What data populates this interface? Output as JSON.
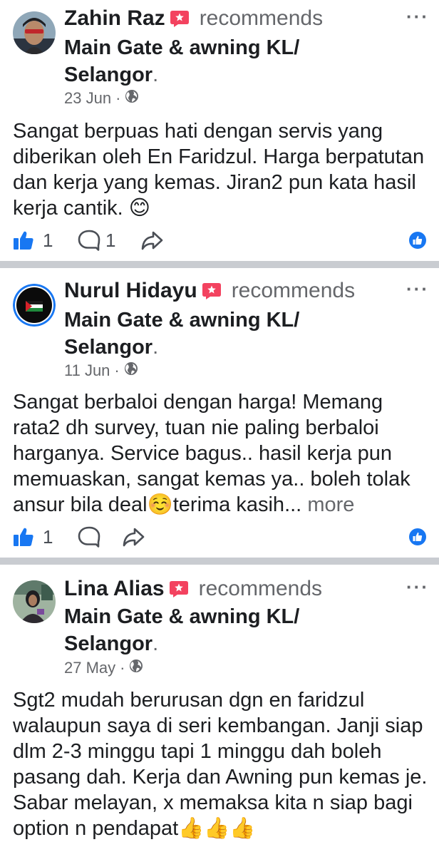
{
  "posts": [
    {
      "author": "Zahin Raz",
      "action": "recommends",
      "page_name_line1": "Main Gate & awning KL/",
      "page_name_line2": "Selangor",
      "page_name_end": ".",
      "date": "23 Jun",
      "separator": "·",
      "privacy_icon": "globe-icon",
      "text": "Sangat berpuas hati dengan servis yang diberikan oleh En Faridzul. Harga berpatutan dan kerja yang kemas. Jiran2 pun kata hasil kerja cantik. 😊",
      "see_more": "",
      "like_count": "1",
      "comment_count": "1"
    },
    {
      "author": "Nurul Hidayu",
      "action": "recommends",
      "page_name_line1": "Main Gate & awning KL/",
      "page_name_line2": "Selangor",
      "page_name_end": ".",
      "date": "11 Jun",
      "separator": "·",
      "privacy_icon": "globe-icon",
      "text": "Sangat berbaloi dengan harga! Memang rata2 dh survey, tuan nie paling berbaloi harganya. Service bagus.. hasil kerja pun memuaskan, sangat kemas ya.. boleh tolak ansur bila deal☺️terima kasih...",
      "see_more": "more",
      "like_count": "1",
      "comment_count": ""
    },
    {
      "author": "Lina Alias",
      "action": "recommends",
      "page_name_line1": "Main Gate & awning KL/",
      "page_name_line2": "Selangor",
      "page_name_end": ".",
      "date": "27 May",
      "separator": "·",
      "privacy_icon": "globe-icon",
      "text": "Sgt2 mudah berurusan dgn en faridzul walaupun saya di seri kembangan. Janji siap dlm 2-3 minggu tapi 1 minggu dah boleh pasang dah. Kerja dan Awning pun kemas je. Sabar melayan, x memaksa kita n siap bagi option n pendapat👍👍👍",
      "see_more": "",
      "like_count": "",
      "comment_count": ""
    }
  ],
  "more_options": "···",
  "colors": {
    "divider": "#c9ccd1",
    "text": "#1c1e21",
    "secondary": "#65676b",
    "recommend_badge": "#f3425f",
    "like_blue": "#1877f2"
  }
}
